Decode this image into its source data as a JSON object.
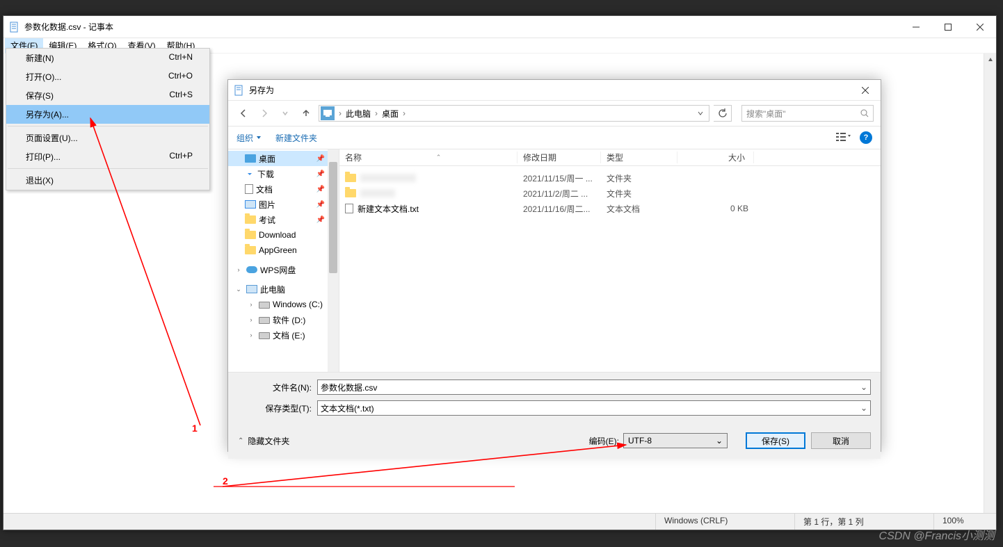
{
  "notepad": {
    "title": "参数化数据.csv - 记事本",
    "menus": {
      "file": "文件(F)",
      "edit": "编辑(E)",
      "format": "格式(O)",
      "view": "查看(V)",
      "help": "帮助(H)"
    },
    "file_menu": {
      "new_": "新建(N)",
      "new_sc": "Ctrl+N",
      "open_": "打开(O)...",
      "open_sc": "Ctrl+O",
      "save_": "保存(S)",
      "save_sc": "Ctrl+S",
      "saveas_": "另存为(A)...",
      "pagesetup_": "页面设置(U)...",
      "print_": "打印(P)...",
      "print_sc": "Ctrl+P",
      "exit_": "退出(X)"
    },
    "status": {
      "eol": "Windows (CRLF)",
      "pos": "第 1 行，第 1 列",
      "zoom": "100%"
    }
  },
  "saveas": {
    "title": "另存为",
    "breadcrumb": {
      "pc": "此电脑",
      "desktop": "桌面"
    },
    "search_placeholder": "搜索\"桌面\"",
    "toolbar": {
      "organize": "组织",
      "newfolder": "新建文件夹"
    },
    "tree": {
      "desktop": "桌面",
      "downloads": "下载",
      "documents": "文档",
      "pictures": "图片",
      "exam": "考试",
      "download_en": "Download",
      "appgreen": "AppGreen",
      "wps": "WPS网盘",
      "thispc": "此电脑",
      "winc": "Windows (C:)",
      "softd": "软件 (D:)",
      "doce": "文档 (E:)"
    },
    "list": {
      "col_name": "名称",
      "col_date": "修改日期",
      "col_type": "类型",
      "col_size": "大小",
      "rows": [
        {
          "name": "",
          "date": "2021/11/15/周一 ...",
          "type": "文件夹",
          "size": "",
          "blur": true
        },
        {
          "name": "",
          "date": "2021/11/2/周二 ...",
          "type": "文件夹",
          "size": "",
          "blur": true
        },
        {
          "name": "新建文本文档.txt",
          "date": "2021/11/16/周二...",
          "type": "文本文档",
          "size": "0 KB",
          "blur": false
        }
      ]
    },
    "fields": {
      "name_label": "文件名(N):",
      "name_value": "参数化数据.csv",
      "type_label": "保存类型(T):",
      "type_value": "文本文档(*.txt)",
      "encoding_label": "编码(E):",
      "encoding_value": "UTF-8",
      "hide_folders": "隐藏文件夹",
      "save_btn": "保存(S)",
      "cancel_btn": "取消"
    }
  },
  "annotations": {
    "label1": "1",
    "label2": "2"
  },
  "watermark": "CSDN @Francis小测测"
}
